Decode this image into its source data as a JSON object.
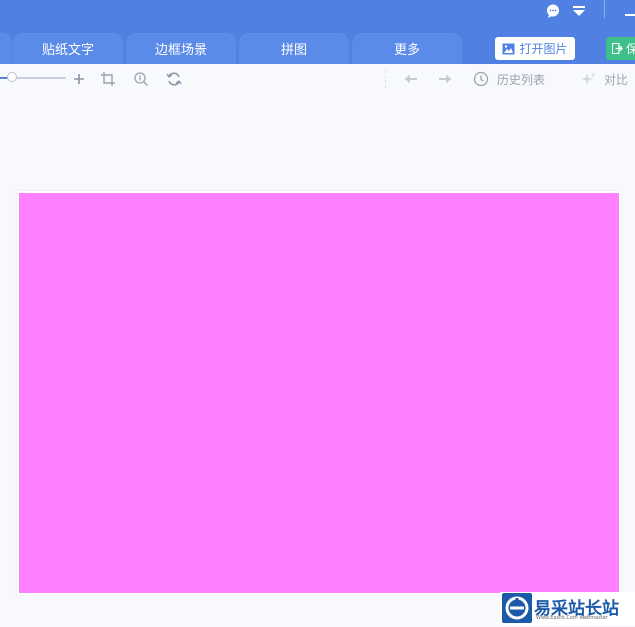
{
  "header": {
    "tabs": [
      {
        "label": ""
      },
      {
        "label": "贴纸文字"
      },
      {
        "label": "边框场景"
      },
      {
        "label": "拼图"
      },
      {
        "label": "更多"
      }
    ],
    "open_button_label": "打开图片",
    "save_button_label": "保"
  },
  "toolbar": {
    "zoom_level": 0.18,
    "history_label": "历史列表",
    "compare_label": "对比"
  },
  "canvas": {
    "fill_color": "#ff80ff"
  },
  "watermark": {
    "name": "易采站长站",
    "subtitle": "Www.Easck.Com Webmaster"
  },
  "colors": {
    "header_blue": "#4f80e2",
    "tab_blue": "#5a8be8",
    "save_green": "#3fbf8a",
    "canvas_magenta": "#ff80ff"
  }
}
